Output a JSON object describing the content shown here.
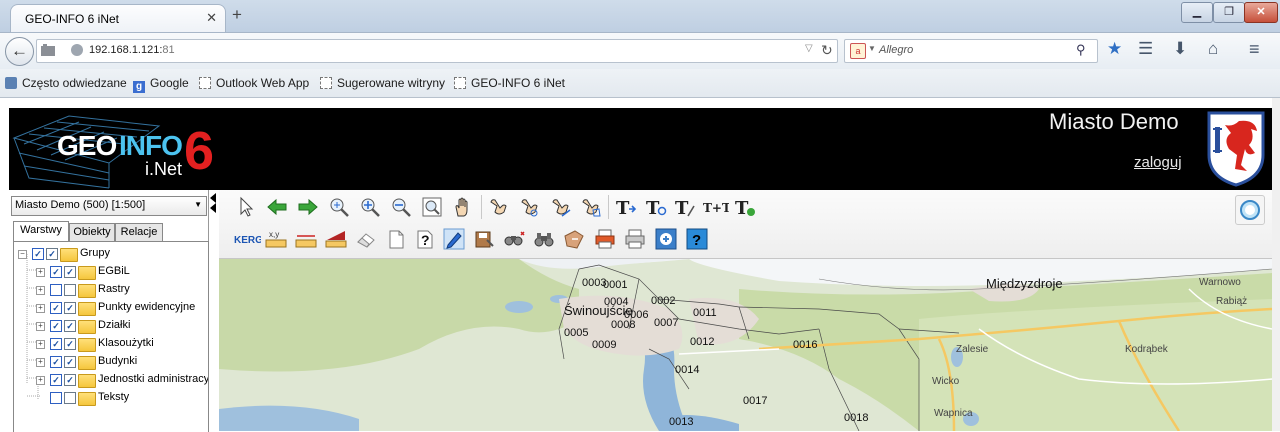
{
  "browser": {
    "tab_title": "GEO-INFO 6 iNet",
    "new_tab_symbol": "+",
    "url_host": "192.168.1.121:",
    "url_port": "81",
    "search_placeholder": "Allegro",
    "bookmarks": [
      "Często odwiedzane",
      "Google",
      "Outlook Web App",
      "Sugerowane witryny",
      "GEO-INFO 6 iNet"
    ]
  },
  "header": {
    "logo_geo": "GEO",
    "logo_info": "INFO",
    "logo_inet": "i.Net",
    "logo_version": "6",
    "city": "Miasto Demo",
    "login": "zaloguj"
  },
  "panel": {
    "scale_select": "Miasto Demo (500) [1:500]",
    "tabs": [
      "Warstwy",
      "Obiekty",
      "Relacje"
    ],
    "layers": [
      {
        "label": "Grupy",
        "level": 0,
        "checked": true
      },
      {
        "label": "EGBiL",
        "level": 1,
        "checked": true
      },
      {
        "label": "Rastry",
        "level": 1,
        "checked": false
      },
      {
        "label": "Punkty ewidencyjne",
        "level": 1,
        "checked": true
      },
      {
        "label": "Działki",
        "level": 1,
        "checked": true
      },
      {
        "label": "Klasoużytki",
        "level": 1,
        "checked": true
      },
      {
        "label": "Budynki",
        "level": 1,
        "checked": true
      },
      {
        "label": "Jednostki administracyjne",
        "level": 1,
        "checked": true
      },
      {
        "label": "Teksty",
        "level": 1,
        "checked": false
      }
    ]
  },
  "toolbar": {
    "kerg_label": "KERG",
    "xy_label": "x,y",
    "help_label": "?"
  },
  "map": {
    "towns": {
      "swinoujscie": "Świnoujście",
      "miedzyzdroje": "Międzyzdroje",
      "warnowo": "Warnowo",
      "rabiaz": "Rabiąż",
      "kodrabek": "Kodrąbek",
      "zalesie": "Zalesie",
      "wicko": "Wicko",
      "wapnica": "Wapnica"
    },
    "parcels": [
      "0001",
      "0002",
      "0003",
      "0004",
      "0005",
      "0006",
      "0007",
      "0008",
      "0009",
      "0011",
      "0012",
      "0013",
      "0014",
      "0016",
      "0017",
      "0018"
    ]
  }
}
